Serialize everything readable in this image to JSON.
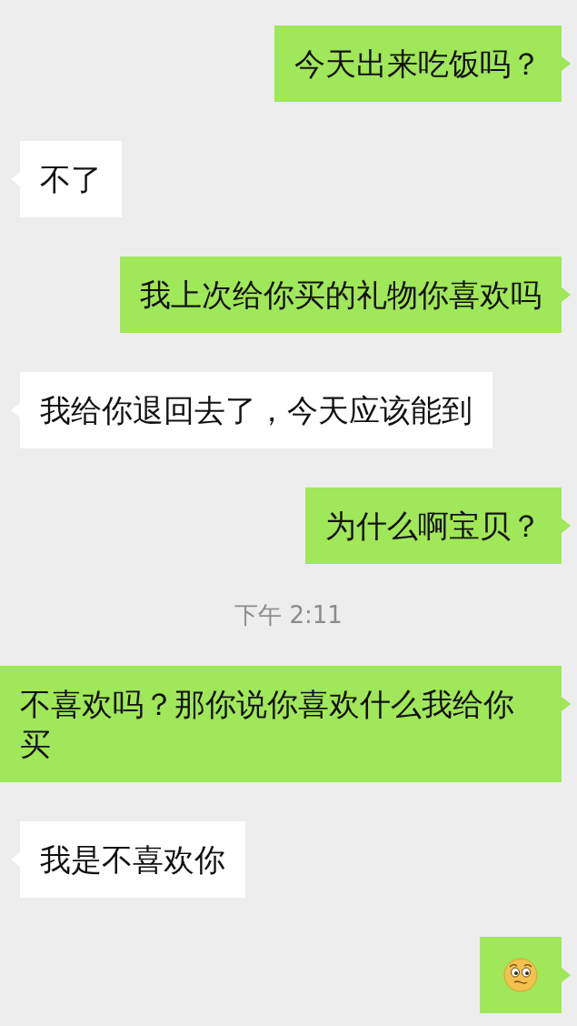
{
  "messages": [
    {
      "kind": "sent",
      "text": "今天出来吃饭吗？"
    },
    {
      "kind": "received",
      "text": "不了"
    },
    {
      "kind": "sent",
      "text": "我上次给你买的礼物你喜欢吗"
    },
    {
      "kind": "received",
      "text": "我给你退回去了，今天应该能到"
    },
    {
      "kind": "sent",
      "text": "为什么啊宝贝？"
    },
    {
      "kind": "time",
      "text": "下午 2:11"
    },
    {
      "kind": "sent",
      "text": "不喜欢吗？那你说你喜欢什么我给你买"
    },
    {
      "kind": "received",
      "text": "我是不喜欢你"
    },
    {
      "kind": "sent_emoji"
    }
  ]
}
